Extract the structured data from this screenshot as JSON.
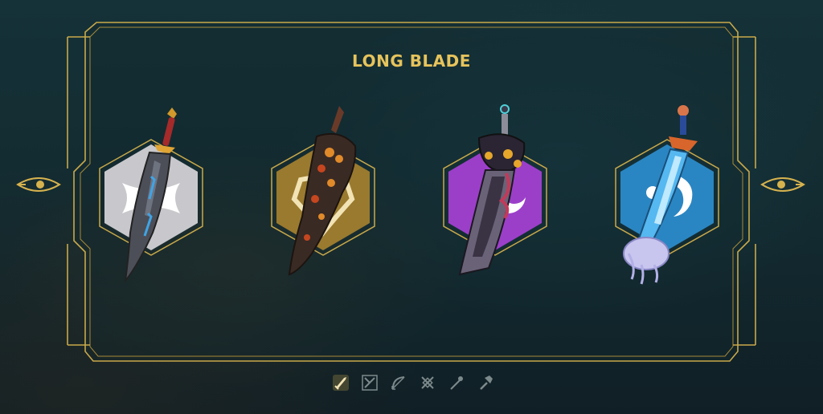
{
  "title": "LONG BLADE",
  "weapons": [
    {
      "element": "wind",
      "badge_color": "#c8c8cc",
      "icon": "wind-element-icon"
    },
    {
      "element": "earth",
      "badge_color": "#9a7a2e",
      "icon": "earth-element-icon"
    },
    {
      "element": "dark",
      "badge_color": "#9b3fc9",
      "icon": "dark-element-icon"
    },
    {
      "element": "water",
      "badge_color": "#2a86c2",
      "icon": "water-element-icon"
    }
  ],
  "categories": [
    {
      "icon": "long-blade-icon",
      "selected": true
    },
    {
      "icon": "dual-blade-icon",
      "selected": false
    },
    {
      "icon": "bow-icon",
      "selected": false
    },
    {
      "icon": "crossed-blades-icon",
      "selected": false
    },
    {
      "icon": "staff-icon",
      "selected": false
    },
    {
      "icon": "hammer-icon",
      "selected": false
    }
  ],
  "colors": {
    "gold": "#d6b24e",
    "title": "#e6c35c",
    "panel_bg": "#132e34"
  }
}
